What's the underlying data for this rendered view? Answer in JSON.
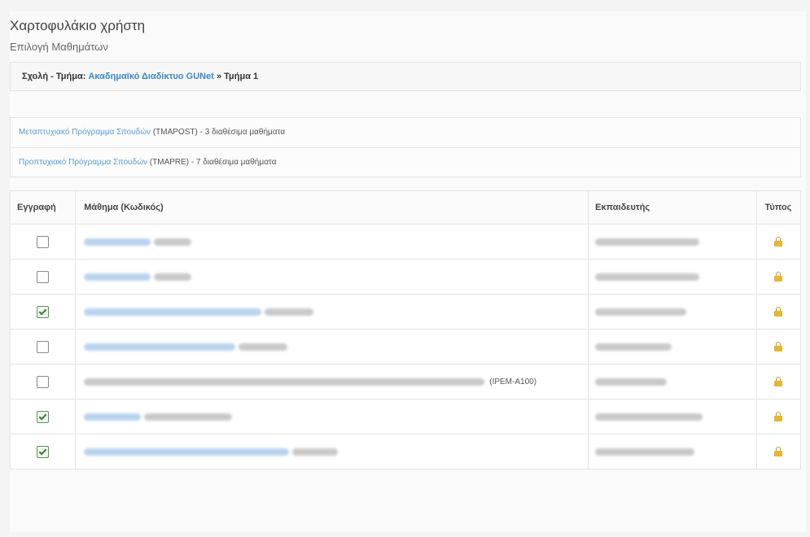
{
  "header": {
    "title": "Χαρτοφυλάκιο χρήστη",
    "subtitle": "Επιλογή Μαθημάτων"
  },
  "faculty": {
    "label": "Σχολή - Τμήμα:",
    "link": "Ακαδημαϊκό Διαδίκτυο GUNet",
    "separator": "»",
    "department": "Τμήμα 1"
  },
  "programs": [
    {
      "name": "Μεταπτυχιακό Πρόγραμμα Σπουδών",
      "code": "(TMAPOST)",
      "info": "- 3 διαθέσιμα μαθήματα"
    },
    {
      "name": "Προπτυχιακό Πρόγραμμα Σπουδών",
      "code": "(TMAPRE)",
      "info": "- 7 διαθέσιμα μαθήματα"
    }
  ],
  "table": {
    "headers": {
      "register": "Εγγραφή",
      "course": "Μάθημα (Κωδικός)",
      "instructor": "Εκπαιδευτής",
      "type": "Τύπος"
    },
    "rows": [
      {
        "checked": false,
        "course_code": "",
        "type_icon": "lock-icon"
      },
      {
        "checked": false,
        "course_code": "",
        "type_icon": "lock-icon"
      },
      {
        "checked": true,
        "course_code": "",
        "type_icon": "lock-icon"
      },
      {
        "checked": false,
        "course_code": "",
        "type_icon": "lock-icon"
      },
      {
        "checked": false,
        "course_code": "(IPEM-A100)",
        "type_icon": "lock-icon"
      },
      {
        "checked": true,
        "course_code": "",
        "type_icon": "lock-icon"
      },
      {
        "checked": true,
        "course_code": "",
        "type_icon": "lock-icon"
      }
    ]
  },
  "colors": {
    "link": "#3b86c8",
    "lock": "#e8b534",
    "check": "#3d7d2c"
  }
}
